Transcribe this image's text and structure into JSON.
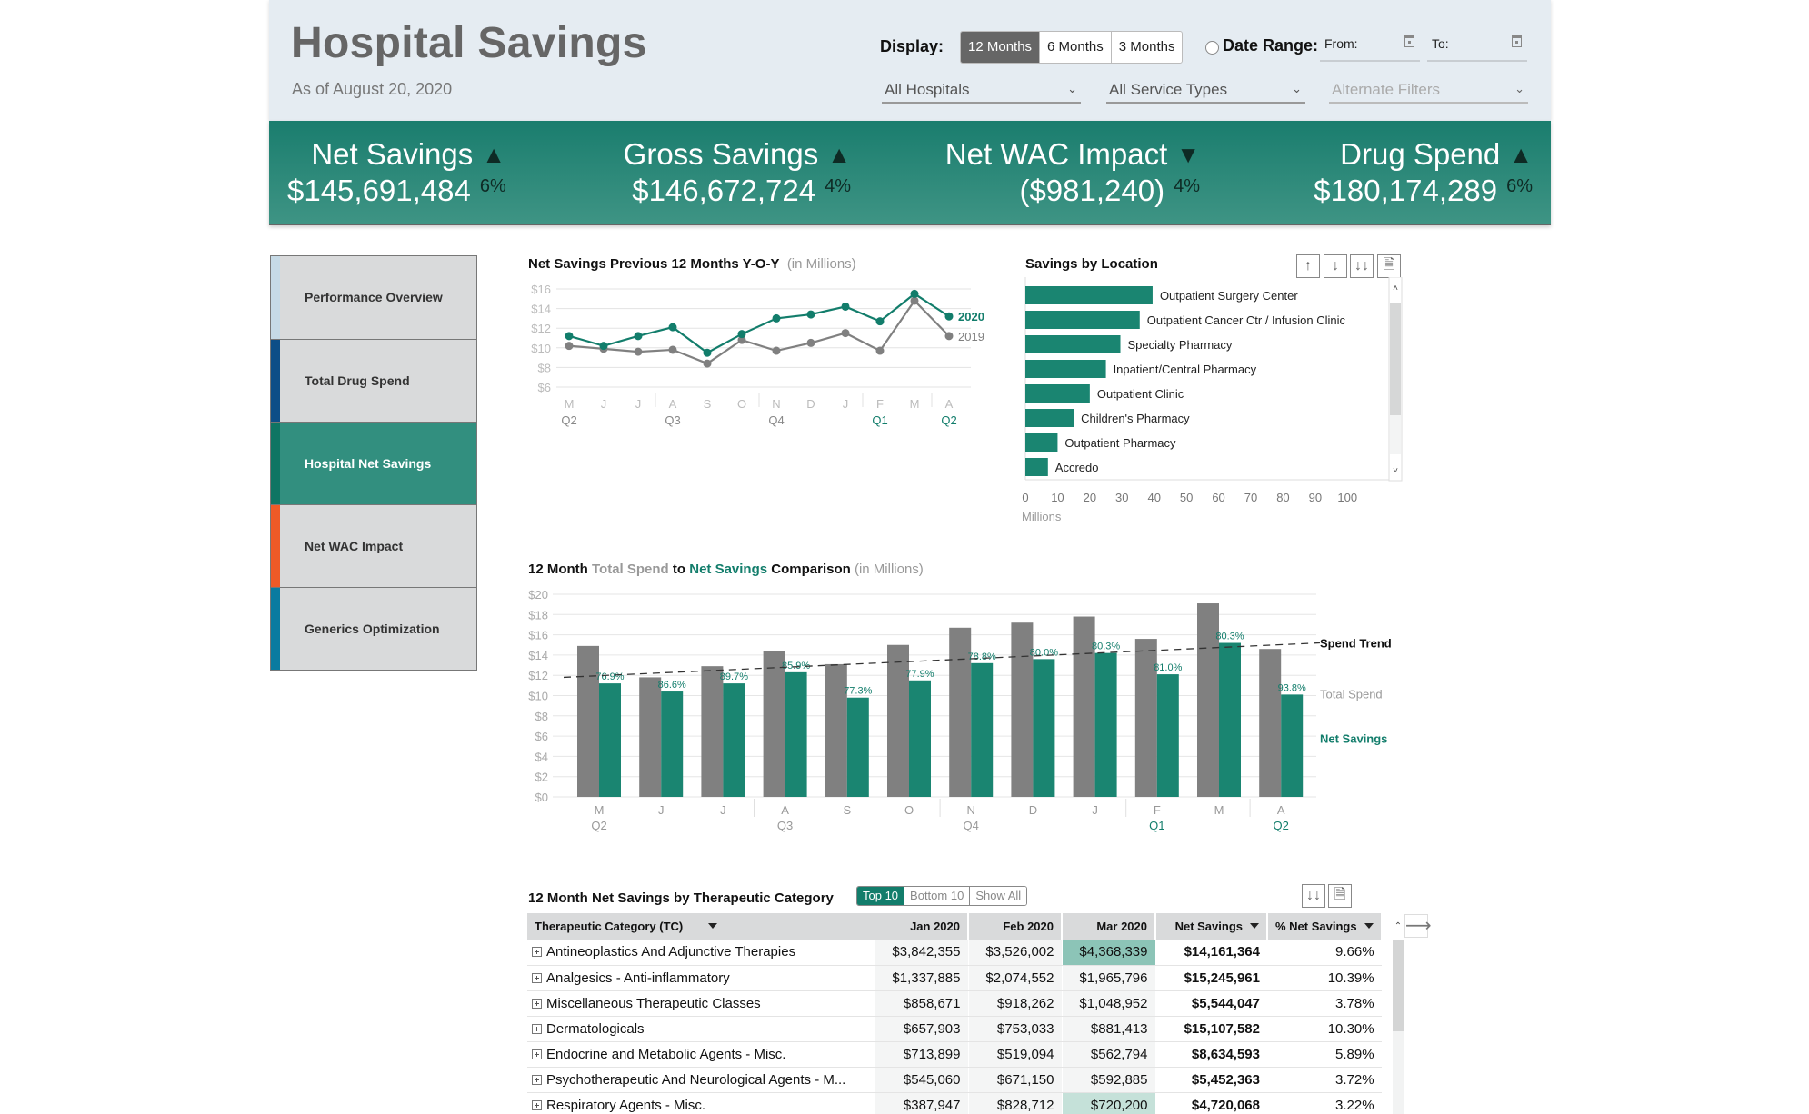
{
  "header": {
    "title": "Hospital Savings",
    "as_of": "As of August 20, 2020",
    "display_label": "Display:",
    "display_options": [
      "12 Months",
      "6 Months",
      "3 Months"
    ],
    "display_selected": "12 Months",
    "date_range_label": "Date Range:",
    "from_label": "From:",
    "to_label": "To:",
    "filters": {
      "hospitals": "All Hospitals",
      "service_types": "All Service Types",
      "alternate": "Alternate Filters"
    }
  },
  "kpis": [
    {
      "name": "Net Savings",
      "value": "$145,691,484",
      "change": "6%",
      "direction": "up"
    },
    {
      "name": "Gross Savings",
      "value": "$146,672,724",
      "change": "4%",
      "direction": "up"
    },
    {
      "name": "Net WAC Impact",
      "value": "($981,240)",
      "change": "4%",
      "direction": "down"
    },
    {
      "name": "Drug Spend",
      "value": "$180,174,289",
      "change": "6%",
      "direction": "up"
    }
  ],
  "sidebar": {
    "items": [
      {
        "label": "Performance Overview",
        "accent": "#c6dae6",
        "active": false
      },
      {
        "label": "Total Drug Spend",
        "accent": "#0d4e87",
        "active": false
      },
      {
        "label": "Hospital Net Savings",
        "accent": "#0e7563",
        "active": true
      },
      {
        "label": "Net WAC Impact",
        "accent": "#ef5a27",
        "active": false
      },
      {
        "label": "Generics Optimization",
        "accent": "#0a7ba0",
        "active": false
      }
    ]
  },
  "colors": {
    "green": "#127d6b",
    "bar_green": "#1a8571",
    "grey": "#808080"
  },
  "chart_data": [
    {
      "id": "yoy",
      "type": "line",
      "title": "Net Savings Previous 12 Months Y-O-Y",
      "subtitle": "(in Millions)",
      "categories": [
        "M",
        "J",
        "J",
        "A",
        "S",
        "O",
        "N",
        "D",
        "J",
        "F",
        "M",
        "A"
      ],
      "quarters": [
        {
          "label": "Q2",
          "index": 0,
          "highlight": false
        },
        {
          "label": "Q3",
          "index": 3,
          "highlight": false
        },
        {
          "label": "Q4",
          "index": 6,
          "highlight": false
        },
        {
          "label": "Q1",
          "index": 9,
          "highlight": true
        },
        {
          "label": "Q2",
          "index": 11,
          "highlight": true
        }
      ],
      "y_ticks": [
        "$6",
        "$8",
        "$10",
        "$12",
        "$14",
        "$16"
      ],
      "ylim": [
        6,
        16
      ],
      "series": [
        {
          "name": "2020",
          "values": [
            11.2,
            10.2,
            11.2,
            12.1,
            9.5,
            11.4,
            13.0,
            13.4,
            14.2,
            12.7,
            15.5,
            13.2
          ]
        },
        {
          "name": "2019",
          "values": [
            10.2,
            9.9,
            9.6,
            9.8,
            8.4,
            10.8,
            9.7,
            10.5,
            11.5,
            9.7,
            14.8,
            11.2
          ]
        }
      ],
      "grid": true
    },
    {
      "id": "location",
      "type": "bar",
      "orientation": "horizontal",
      "title": "Savings by Location",
      "categories": [
        "Outpatient Surgery Center",
        "Outpatient Cancer Ctr / Infusion Clinic",
        "Specialty Pharmacy",
        "Inpatient/Central Pharmacy",
        "Outpatient Clinic",
        "Children's Pharmacy",
        "Outpatient Pharmacy",
        "Accredo"
      ],
      "values": [
        39.5,
        35.5,
        29.5,
        25,
        20,
        15,
        10,
        7
      ],
      "x_ticks": [
        "0",
        "10",
        "20",
        "30",
        "40",
        "50",
        "60",
        "70",
        "80",
        "90",
        "100"
      ],
      "xlim": [
        0,
        105
      ],
      "xlabel": "Millions"
    },
    {
      "id": "comparison",
      "type": "bar",
      "title_parts": [
        "12 Month ",
        "Total Spend",
        " to ",
        "Net Savings",
        " Comparison",
        " (in Millions)"
      ],
      "categories": [
        "M",
        "J",
        "J",
        "A",
        "S",
        "O",
        "N",
        "D",
        "J",
        "F",
        "M",
        "A"
      ],
      "quarters": [
        {
          "label": "Q2",
          "index": 0,
          "highlight": false
        },
        {
          "label": "Q3",
          "index": 3,
          "highlight": false
        },
        {
          "label": "Q4",
          "index": 6,
          "highlight": false
        },
        {
          "label": "Q1",
          "index": 9,
          "highlight": true
        },
        {
          "label": "Q2",
          "index": 11,
          "highlight": true
        }
      ],
      "y_ticks": [
        "$0",
        "$2",
        "$4",
        "$6",
        "$8",
        "$10",
        "$12",
        "$14",
        "$16",
        "$18",
        "$20"
      ],
      "ylim": [
        0,
        20
      ],
      "series": [
        {
          "name": "Total Spend",
          "values": [
            14.9,
            11.8,
            12.9,
            14.4,
            13.1,
            15.0,
            16.7,
            17.2,
            17.8,
            15.6,
            19.1,
            14.6
          ]
        },
        {
          "name": "Net Savings",
          "values": [
            11.2,
            10.4,
            11.2,
            12.3,
            9.8,
            11.5,
            13.2,
            13.6,
            14.2,
            12.1,
            15.2,
            10.1
          ]
        }
      ],
      "ratio_labels": [
        "76.9%",
        "86.6%",
        "89.7%",
        "85.9%",
        "77.3%",
        "77.9%",
        "78.8%",
        "80.0%",
        "80.3%",
        "81.0%",
        "80.3%",
        "93.8%"
      ],
      "trend": {
        "name": "Spend Trend",
        "start": 11.8,
        "end": 15.2
      },
      "legend": [
        "Spend Trend",
        "Total Spend",
        "Net Savings"
      ]
    }
  ],
  "table": {
    "title": "12 Month Net Savings by Therapeutic Category",
    "toggle": [
      "Top 10",
      "Bottom 10",
      "Show All"
    ],
    "toggle_selected": "Top 10",
    "columns": [
      "Therapeutic Category (TC)",
      "Jan 2020",
      "Feb 2020",
      "Mar 2020",
      "Net Savings",
      "% Net Savings"
    ],
    "rows": [
      {
        "tc": "Antineoplastics And Adjunctive Therapies",
        "jan": "$3,842,355",
        "feb": "$3,526,002",
        "mar": "$4,368,339",
        "net": "$14,161,364",
        "pct": "9.66%",
        "mar_hl": "strong"
      },
      {
        "tc": "Analgesics - Anti-inflammatory",
        "jan": "$1,337,885",
        "feb": "$2,074,552",
        "mar": "$1,965,796",
        "net": "$15,245,961",
        "pct": "10.39%",
        "mar_hl": ""
      },
      {
        "tc": "Miscellaneous Therapeutic Classes",
        "jan": "$858,671",
        "feb": "$918,262",
        "mar": "$1,048,952",
        "net": "$5,544,047",
        "pct": "3.78%",
        "mar_hl": ""
      },
      {
        "tc": "Dermatologicals",
        "jan": "$657,903",
        "feb": "$753,033",
        "mar": "$881,413",
        "net": "$15,107,582",
        "pct": "10.30%",
        "mar_hl": ""
      },
      {
        "tc": "Endocrine and Metabolic Agents - Misc.",
        "jan": "$713,899",
        "feb": "$519,094",
        "mar": "$562,794",
        "net": "$8,634,593",
        "pct": "5.89%",
        "mar_hl": ""
      },
      {
        "tc": "Psychotherapeutic And Neurological Agents - M...",
        "jan": "$545,060",
        "feb": "$671,150",
        "mar": "$592,885",
        "net": "$5,452,363",
        "pct": "3.72%",
        "mar_hl": ""
      },
      {
        "tc": "Respiratory Agents - Misc.",
        "jan": "$387,947",
        "feb": "$828,712",
        "mar": "$720,200",
        "net": "$4,720,068",
        "pct": "3.22%",
        "mar_hl": "light"
      }
    ]
  },
  "icons": {
    "sort_asc": "arrow-up-icon",
    "sort_desc": "arrow-down-icon",
    "sort_default": "double-arrow-down-icon",
    "export": "export-document-icon",
    "scroll_right": "arrow-right-icon"
  }
}
